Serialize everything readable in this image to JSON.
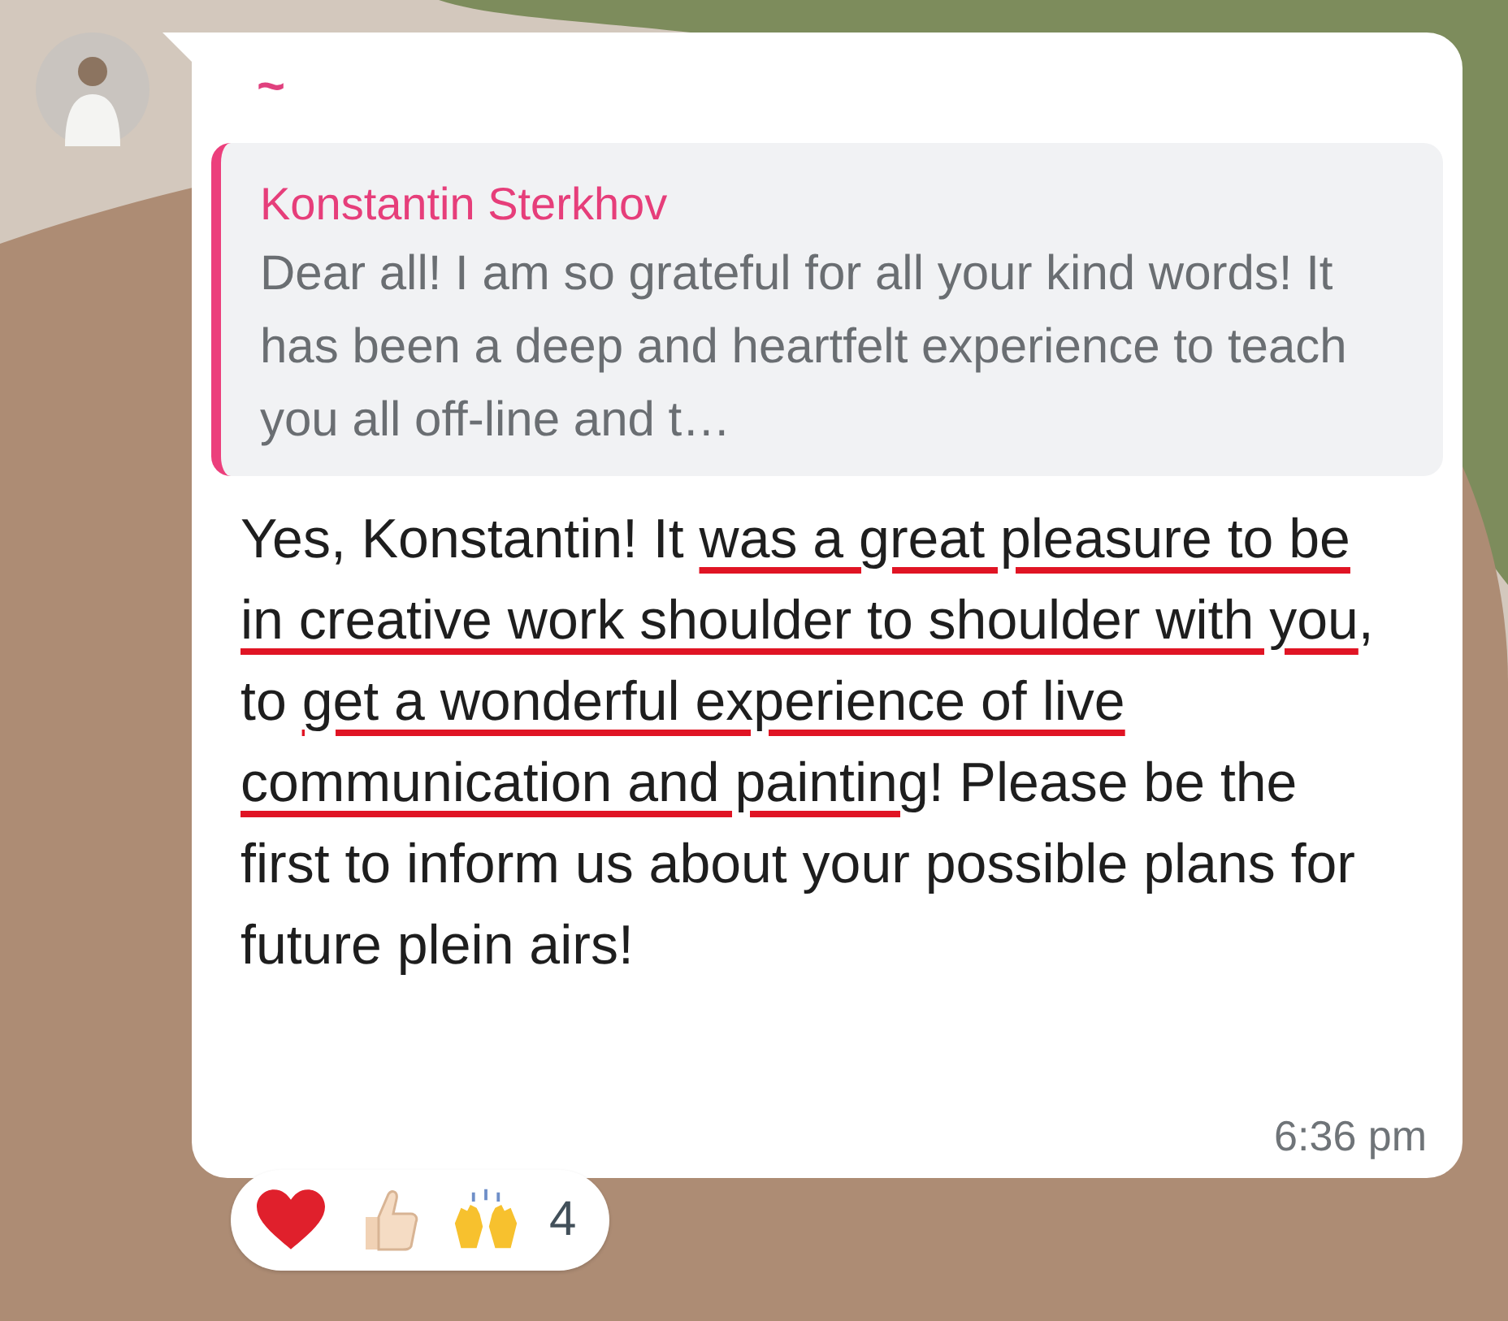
{
  "message": {
    "sender_mark": "~",
    "quote": {
      "author": "Konstantin Sterkhov",
      "text": "Dear all! I am so grateful for all your kind words! It has been a deep and heartfelt experience to teach you all off-line and t…"
    },
    "body": [
      {
        "text": "Yes, Konstantin! It ",
        "underlined": false
      },
      {
        "text": "was a great pleasure to be in creative work shoulder to shoulder with you",
        "underlined": true
      },
      {
        "text": ", to ",
        "underlined": false
      },
      {
        "text": "get a wonderful experience of live communication and painting",
        "underlined": true
      },
      {
        "text": "! Please be the first to inform us about your possible plans for future plein airs!",
        "underlined": false
      }
    ],
    "time": "6:36 pm",
    "reactions": {
      "count": "4"
    }
  }
}
